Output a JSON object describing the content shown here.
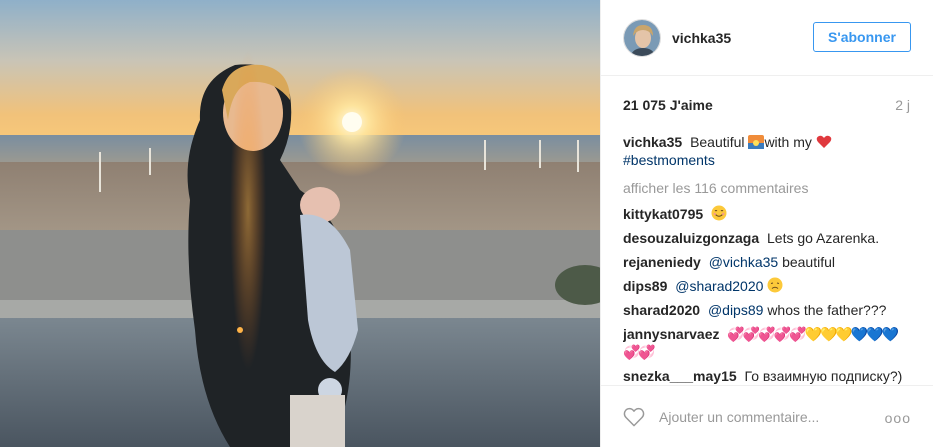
{
  "post": {
    "photo_alt": "",
    "author": {
      "username": "vichka35"
    },
    "follow_label": "S'abonner",
    "likes_text": "21 075 J'aime",
    "age_text": "2 j",
    "caption": {
      "username": "vichka35",
      "text_before": "Beautiful",
      "text_after": "with my",
      "hashtag": "#bestmoments"
    },
    "view_more_text": "afficher les 116 commentaires",
    "comments": [
      {
        "username": "kittykat0795",
        "text": "",
        "emoji": "blush"
      },
      {
        "username": "desouzaluizgonzaga",
        "text": "Lets go Azarenka."
      },
      {
        "username": "rejaneniedy",
        "mention": "@vichka35",
        "text": "beautiful"
      },
      {
        "username": "dips89",
        "mention": "@sharad2020",
        "emoji": "disappointed"
      },
      {
        "username": "sharad2020",
        "mention": "@dips89",
        "text": "whos the father???"
      },
      {
        "username": "jannysnarvaez",
        "emoji": "hearts"
      },
      {
        "username": "snezka___may15",
        "text": "Го взаимную подписку?)"
      }
    ],
    "comment_placeholder": "Ajouter un commentaire...",
    "more_options": "ooo",
    "colors": {
      "accent": "#3897f0",
      "link": "#003569",
      "muted": "#999999",
      "heart_red": "#ed4956"
    },
    "icons": {
      "like": "heart-outline-icon",
      "more": "ellipsis-icon"
    }
  }
}
